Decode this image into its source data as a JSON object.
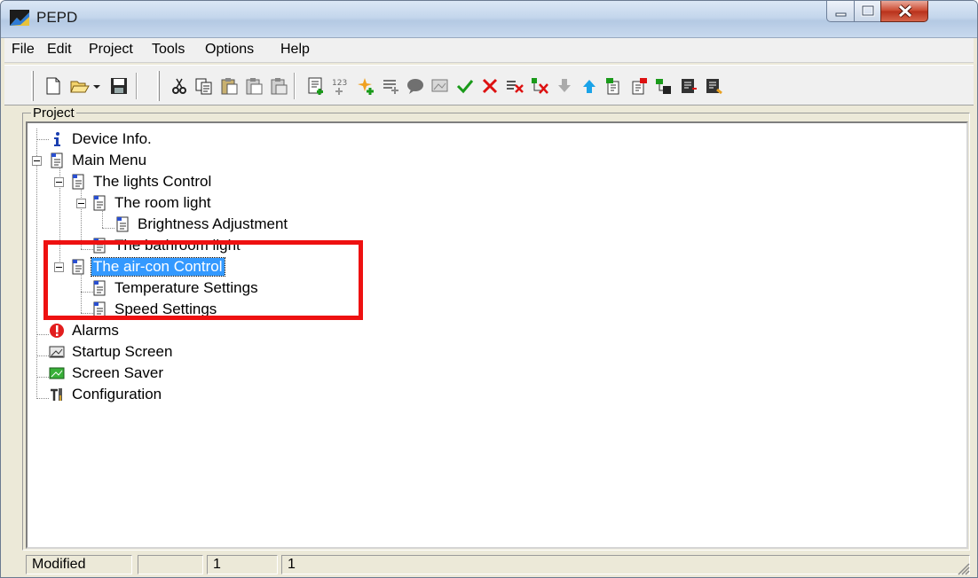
{
  "window": {
    "title": "PEPD",
    "accent": "#3399ff",
    "highlight_color": "#ee1111"
  },
  "menu": {
    "items": [
      "File",
      "Edit",
      "Project",
      "Tools",
      "Options",
      "Help"
    ]
  },
  "toolbar": {
    "buttons": [
      "new-document-icon",
      "open-folder-icon",
      "dropdown-arrow-icon",
      "save-icon",
      "cut-icon",
      "copy-icon",
      "paste-icon",
      "paste-special-icon",
      "paste-format-icon",
      "add-page-icon",
      "numeric-field-icon",
      "sparkle-add-icon",
      "list-icon",
      "bubble-icon",
      "screen-icon",
      "check-icon",
      "cross-icon",
      "delete-items-icon",
      "delete-tree-icon",
      "move-down-icon",
      "move-up-icon",
      "page-green-icon",
      "page-red-icon",
      "send-icon",
      "export-icon",
      "import-icon"
    ]
  },
  "project": {
    "label": "Project",
    "tree": [
      {
        "id": "device-info",
        "label": "Device Info.",
        "icon": "info-icon"
      },
      {
        "id": "main-menu",
        "label": "Main Menu",
        "icon": "menu-page-icon"
      },
      {
        "id": "lights-control",
        "label": "The lights Control",
        "icon": "menu-page-icon"
      },
      {
        "id": "room-light",
        "label": "The room light",
        "icon": "menu-page-icon"
      },
      {
        "id": "brightness",
        "label": "Brightness Adjustment",
        "icon": "menu-page-icon"
      },
      {
        "id": "bathroom-light",
        "label": "The bathroom light",
        "icon": "menu-page-icon"
      },
      {
        "id": "aircon-control",
        "label": "The air-con Control",
        "icon": "menu-page-icon",
        "selected": true
      },
      {
        "id": "temperature",
        "label": "Temperature Settings",
        "icon": "menu-page-icon"
      },
      {
        "id": "speed",
        "label": "Speed Settings",
        "icon": "menu-page-icon"
      },
      {
        "id": "alarms",
        "label": "Alarms",
        "icon": "alarm-icon"
      },
      {
        "id": "startup",
        "label": "Startup Screen",
        "icon": "image-icon"
      },
      {
        "id": "screensaver",
        "label": "Screen Saver",
        "icon": "image-green-icon"
      },
      {
        "id": "configuration",
        "label": "Configuration",
        "icon": "tools-icon"
      }
    ]
  },
  "status": {
    "state": "Modified",
    "pane2": "",
    "pane3": "1",
    "pane4": "1"
  }
}
